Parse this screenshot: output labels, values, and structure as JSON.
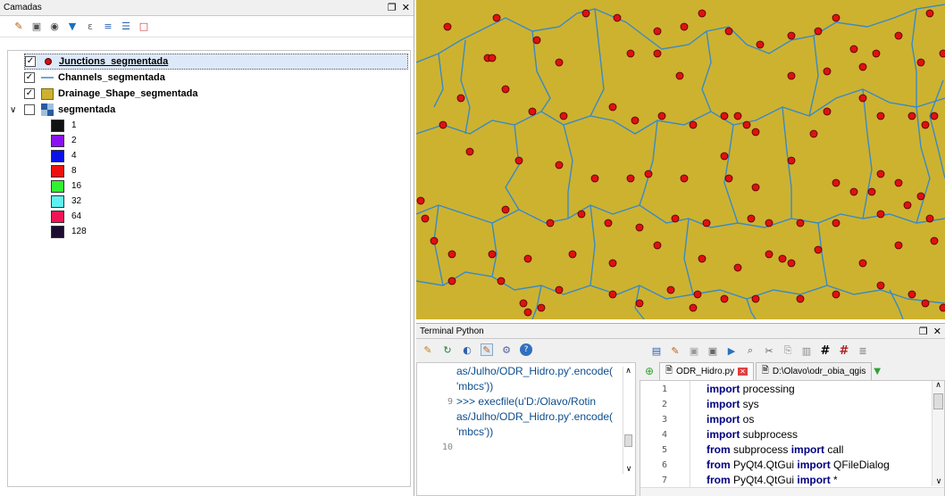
{
  "layers_panel": {
    "title": "Camadas",
    "float_icon": "float-icon",
    "close_icon": "close-icon",
    "toolbar": [
      "style-brush-icon",
      "add-group-icon",
      "eye-icon",
      "filter-icon",
      "filter-expression-icon",
      "expand-all-icon",
      "collapse-all-icon",
      "remove-layer-icon"
    ],
    "layers": [
      {
        "name": "Junctions_segmentada",
        "checked": true,
        "selected": true,
        "icon": "point-symbol-icon"
      },
      {
        "name": "Channels_segmentada",
        "checked": true,
        "selected": false,
        "icon": "line-symbol-icon"
      },
      {
        "name": "Drainage_Shape_segmentada",
        "checked": true,
        "selected": false,
        "icon": "polygon-symbol-icon"
      },
      {
        "name": "segmentada",
        "checked": false,
        "selected": false,
        "icon": "raster-icon",
        "expanded": true
      }
    ],
    "raster_legend": [
      {
        "label": "1",
        "color": "#111111"
      },
      {
        "label": "2",
        "color": "#8b10f0"
      },
      {
        "label": "4",
        "color": "#0a10e8"
      },
      {
        "label": "8",
        "color": "#f01010"
      },
      {
        "label": "16",
        "color": "#33f032"
      },
      {
        "label": "32",
        "color": "#60f0f0"
      },
      {
        "label": "64",
        "color": "#ee1456"
      },
      {
        "label": "128",
        "color": "#1c0c30"
      }
    ]
  },
  "map": {
    "background": "#cdb230",
    "channel_color": "#3a8ac4",
    "junction_color": "#e01010"
  },
  "terminal": {
    "title": "Terminal Python",
    "console_tools": [
      "clear-console-icon",
      "run-command-icon",
      "python-icon",
      "show-editor-icon",
      "settings-icon",
      "help-icon"
    ],
    "console_lines": [
      {
        "num": "",
        "text": "as/Julho/ODR_Hidro.py'.encode("
      },
      {
        "num": "",
        "text": "'mbcs'))"
      },
      {
        "num": "9",
        "text": ">>> execfile(u'D:/Olavo/Rotin"
      },
      {
        "num": "",
        "text": "as/Julho/ODR_Hidro.py'.encode("
      },
      {
        "num": "",
        "text": "'mbcs'))"
      },
      {
        "num": "10",
        "text": ""
      }
    ],
    "prompt": ">>>",
    "editor_tools": [
      "open-file-icon",
      "open-external-icon",
      "save-icon",
      "save-as-icon",
      "run-script-icon",
      "find-icon",
      "cut-icon",
      "copy-icon",
      "paste-icon",
      "comment-icon",
      "uncomment-icon",
      "object-inspector-icon"
    ],
    "tabs": [
      {
        "label": "ODR_Hidro.py",
        "closable": true
      },
      {
        "label": "D:\\Olavo\\odr_obia_qgis"
      }
    ],
    "code_lines": [
      {
        "num": "1",
        "kw": "import",
        "rest": " processing"
      },
      {
        "num": "2",
        "kw": "import",
        "rest": " sys"
      },
      {
        "num": "3",
        "kw": "import",
        "rest": " os"
      },
      {
        "num": "4",
        "kw": "import",
        "rest": " subprocess"
      },
      {
        "num": "5",
        "kw": "from",
        "rest": " subprocess ",
        "kw2": "import",
        "rest2": " call"
      },
      {
        "num": "6",
        "kw": "from",
        "rest": " PyQt4.QtGui ",
        "kw2": "import",
        "rest2": " QFileDialog"
      },
      {
        "num": "7",
        "kw": "from",
        "rest": " PyQt4.QtGui ",
        "kw2": "import",
        "rest2": " *"
      }
    ]
  }
}
